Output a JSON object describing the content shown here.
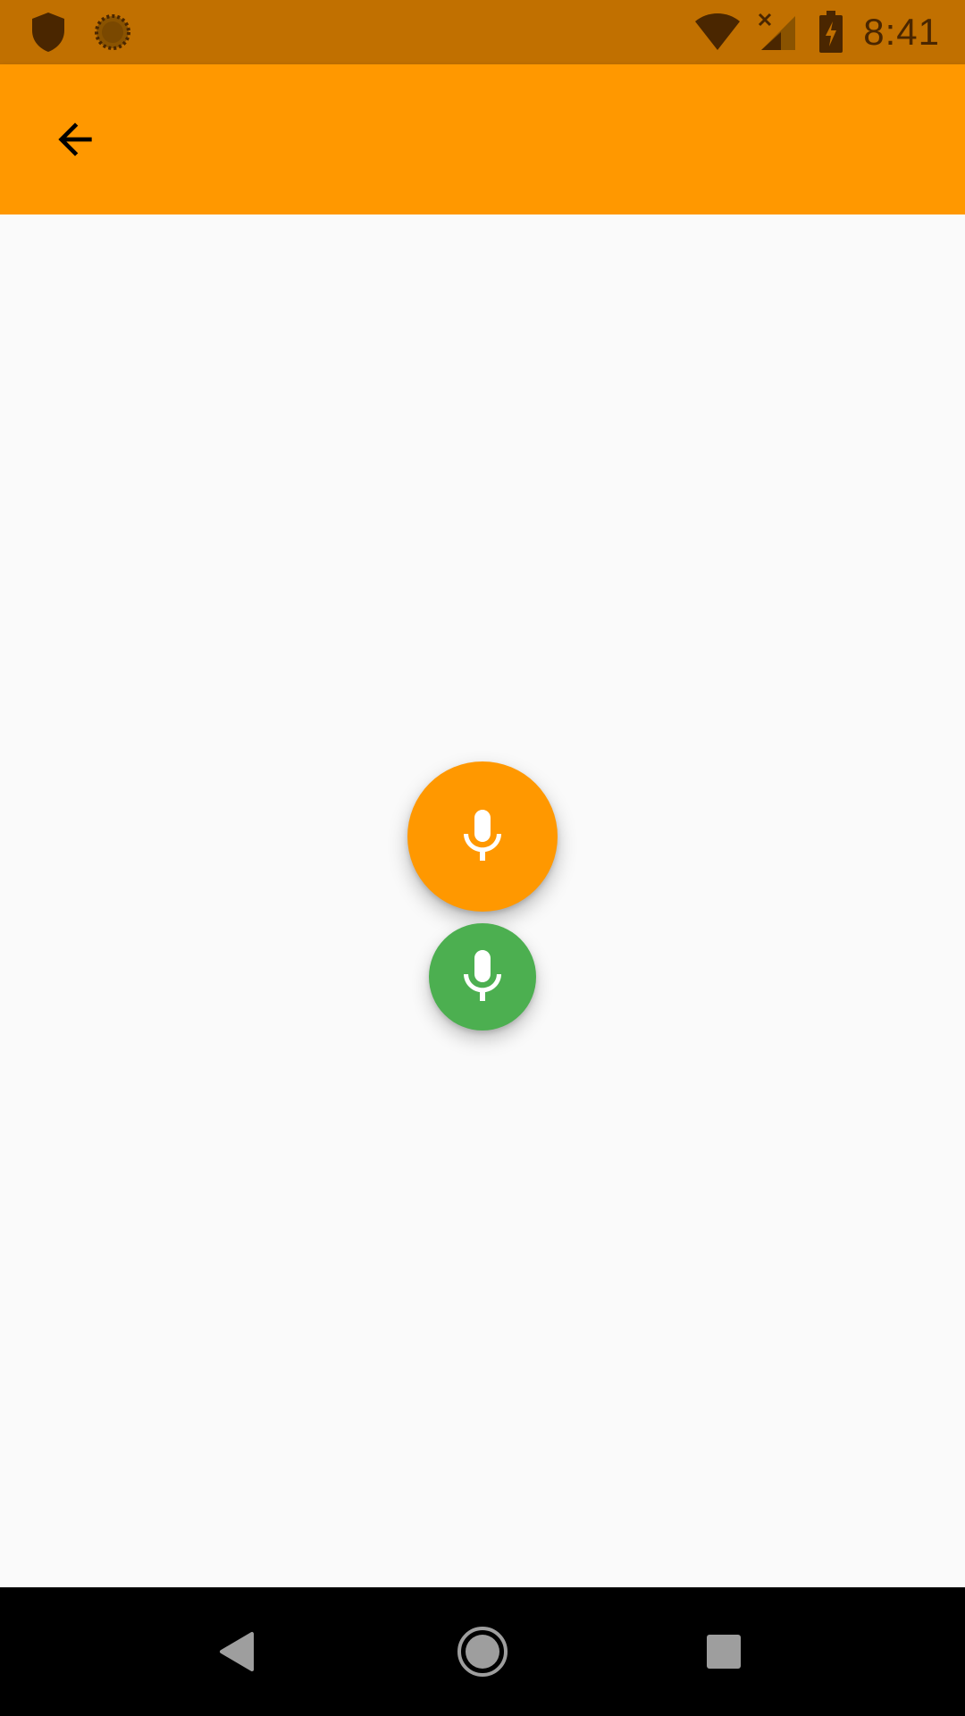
{
  "status_bar": {
    "time": "8:41",
    "icons": [
      "shield-icon",
      "sync-spinner-icon",
      "wifi-icon",
      "cell-signal-no-service-icon",
      "battery-charging-icon"
    ],
    "background": "#C17000"
  },
  "app_bar": {
    "background": "#FF9800",
    "back_icon": "arrow-back-icon"
  },
  "fabs": [
    {
      "icon": "microphone-icon",
      "color": "#FF9800",
      "size": "large"
    },
    {
      "icon": "microphone-icon",
      "color": "#4CAF50",
      "size": "small"
    }
  ],
  "nav_bar": {
    "items": [
      "back-triangle-icon",
      "home-circle-icon",
      "recents-square-icon"
    ],
    "background": "#000000"
  }
}
